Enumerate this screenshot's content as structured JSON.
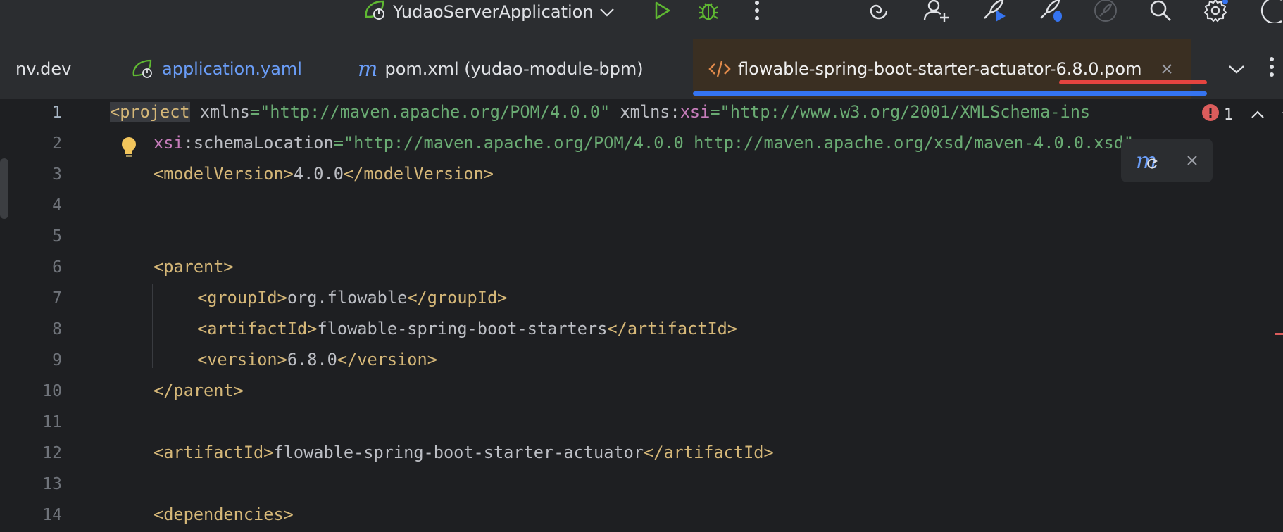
{
  "toolbar": {
    "run_config": "YudaoServerApplication"
  },
  "tabs": [
    {
      "label": "nv.dev",
      "type": "file"
    },
    {
      "label": "application.yaml",
      "type": "yaml"
    },
    {
      "label": "pom.xml (yudao-module-bpm)",
      "type": "maven"
    },
    {
      "label": "flowable-spring-boot-starter-actuator-6.8.0.pom",
      "type": "xml",
      "active": true
    }
  ],
  "editor": {
    "error_count": "1",
    "lines": [
      {
        "n": "1"
      },
      {
        "n": "2"
      },
      {
        "n": "3"
      },
      {
        "n": "4"
      },
      {
        "n": "5"
      },
      {
        "n": "6"
      },
      {
        "n": "7"
      },
      {
        "n": "8"
      },
      {
        "n": "9"
      },
      {
        "n": "10"
      },
      {
        "n": "11"
      },
      {
        "n": "12"
      },
      {
        "n": "13"
      },
      {
        "n": "14"
      }
    ],
    "code": {
      "l1_tag": "<project",
      "l1_a1": " xmlns",
      "l1_eq1": "=",
      "l1_v1": "\"http://maven.apache.org/POM/4.0.0\"",
      "l1_a2": " xmlns:",
      "l1_ns": "xsi",
      "l1_eq2": "=",
      "l1_v2": "\"http://www.w3.org/2001/XMLSchema-ins",
      "l2_ns": "xsi",
      "l2_a": ":schemaLocation",
      "l2_eq": "=",
      "l2_v": "\"http://maven.apache.org/POM/4.0.0 http://maven.apache.org/xsd/maven-4.0.0.xsd\"",
      "l2_close": ">",
      "l3_open": "<modelVersion>",
      "l3_val": "4.0.0",
      "l3_close": "</modelVersion>",
      "l6": "<parent>",
      "l7_open": "<groupId>",
      "l7_val": "org.flowable",
      "l7_close": "</groupId>",
      "l8_open": "<artifactId>",
      "l8_val": "flowable-spring-boot-starters",
      "l8_close": "</artifactId>",
      "l9_open": "<version>",
      "l9_val": "6.8.0",
      "l9_close": "</version>",
      "l10": "</parent>",
      "l12_open": "<artifactId>",
      "l12_val": "flowable-spring-boot-starter-actuator",
      "l12_close": "</artifactId>",
      "l14": "<dependencies>"
    }
  },
  "colors": {
    "accent": "#3574f0",
    "annotation_red": "#e5443f",
    "xml_tag": "#d5b778",
    "xml_string": "#6aab73",
    "xml_namespace": "#c77dbb"
  }
}
